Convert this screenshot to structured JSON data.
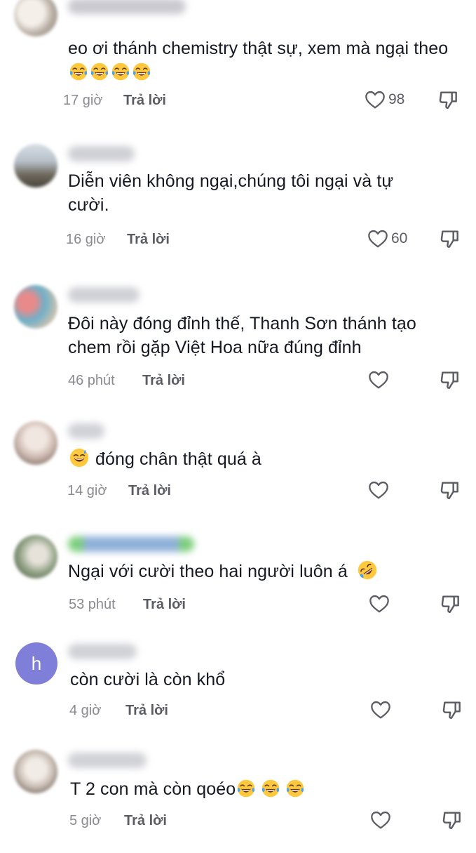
{
  "comments": [
    {
      "username": "Nhu Hương mỹ",
      "text": "eo ơi thánh chemistry thật sự, xem mà ngại theo",
      "emojis": [
        "face-with-tears-of-joy",
        "face-with-tears-of-joy",
        "face-with-tears-of-joy",
        "face-with-tears-of-joy"
      ],
      "time": "17 giờ",
      "reply": "Trả lời",
      "likes": "98"
    },
    {
      "username": "Sonn287",
      "text": "Diễn viên không ngại,chúng tôi ngại và tự cười.",
      "time": "16 giờ",
      "reply": "Trả lời",
      "likes": "60"
    },
    {
      "username": "Hoa Miny",
      "text": "Đôi này đóng đỉnh thế, Thanh Sơn thánh tạo chem rồi gặp Việt Hoa nữa đúng đỉnh",
      "time": "46 phút",
      "reply": "Trả lời",
      "likes": ""
    },
    {
      "username": "Thuỳ",
      "text": "đóng chân thật quá à",
      "emojis": [
        "grinning-face-with-sweat"
      ],
      "time": "14 giờ",
      "reply": "Trả lời",
      "likes": ""
    },
    {
      "username": "🍀ĐĐĐĐ🍀",
      "text": "Ngại với cười theo hai người luôn á",
      "emojis": [
        "rolling-on-the-floor-laughing"
      ],
      "time": "53 phút",
      "reply": "Trả lời",
      "likes": ""
    },
    {
      "username": "hieu tran",
      "avatar_letter": "h",
      "text": "còn cười là còn khổ",
      "time": "4 giờ",
      "reply": "Trả lời",
      "likes": ""
    },
    {
      "username": "Mơ Khánh",
      "text": "T 2 con mà còn qoéo",
      "emojis": [
        "face-with-tears-of-joy",
        "face-with-tears-of-joy",
        "face-with-tears-of-joy"
      ],
      "time": "5 giờ",
      "reply": "Trả lời",
      "likes": ""
    }
  ],
  "icons": {
    "like": "heart-outline-icon",
    "dislike": "thumbs-down-outline-icon"
  },
  "colors": {
    "text": "#161823",
    "meta": "#8a8b91",
    "icon": "#5b5c63",
    "letter_avatar": "#7f7fd9"
  }
}
